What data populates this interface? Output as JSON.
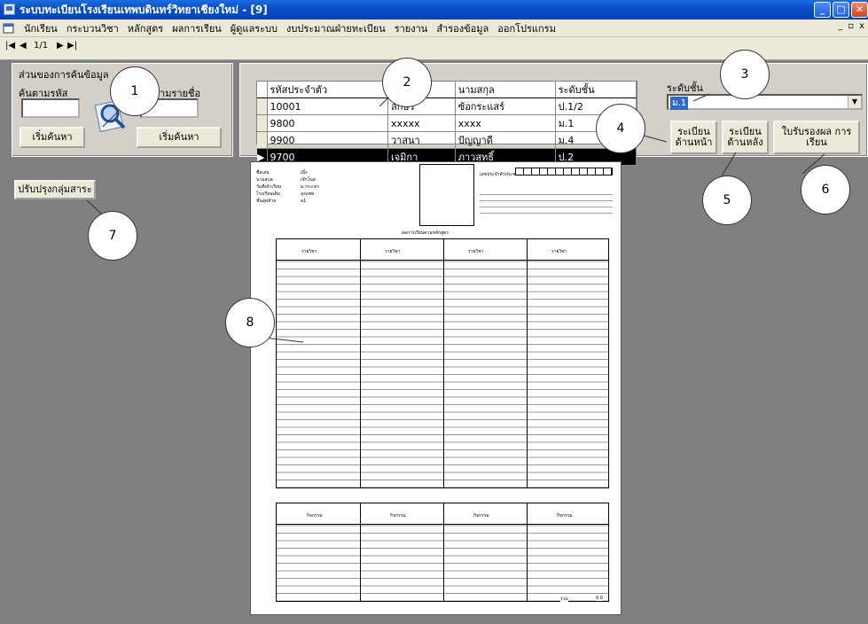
{
  "window": {
    "title": "ระบบทะเบียนโรงเรียนเทพบดินทร์วิทยาเชียงใหม่ - [9]"
  },
  "menu": [
    "นักเรียน",
    "กระบวนวิชา",
    "หลักสูตร",
    "ผลการเรียน",
    "ผู้ดูแลระบบ",
    "งบประมาณฝ่ายทะเบียน",
    "รายงาน",
    "สำรองข้อมูล",
    "ออกโปรแกรม"
  ],
  "nav": {
    "page": "1/1"
  },
  "search": {
    "group_title": "ส่วนของการค้นข้อมูล",
    "by_code_label": "ค้นตามรหัส",
    "by_name_label": "ค้นตามรายชื่อ",
    "code_value": "",
    "name_value": "",
    "search_button_1": "เริ่มค้นหา",
    "search_button_2": "เริ่มค้นหา"
  },
  "grid": {
    "columns": [
      "รหัสประจำตัว",
      "ชื่อ",
      "นามสกุล",
      "ระดับชั้น"
    ],
    "rows": [
      [
        "10001",
        "ลักษร",
        "ซ้อกระแสร์",
        "ป.1/2"
      ],
      [
        "9800",
        "xxxxx",
        "xxxx",
        "ม.1"
      ],
      [
        "9900",
        "วาสนา",
        "ปัญญาดี",
        "ม.4"
      ],
      [
        "9700",
        "เจมิกา",
        "ภาวสุทธิ์",
        "ป.2"
      ]
    ]
  },
  "level": {
    "label": "ระดับชั้น",
    "selected": "ม.1"
  },
  "buttons": {
    "front": "ระเบียน ด้านหน้า",
    "back": "ระเบียน ด้านหลัง",
    "certificate": "ใบรับรองผล การเรียน",
    "update_group": "ปรับปรุงกลุ่มสาระ"
  },
  "callouts": [
    "1",
    "2",
    "3",
    "4",
    "5",
    "6",
    "7",
    "8"
  ],
  "report": {
    "header_left": [
      "ชื่อเล่น",
      "นามสกุล",
      "วันที่เข้าเรียน",
      "โรงเรียนเดิม",
      "ชั้นสุดท้าย"
    ],
    "header_left_vals": [
      "เมิ้ง",
      "เจ๊กโนส",
      "ม.กระเหว",
      "ลุงแพท",
      "a1"
    ],
    "header_right": "เลขประจำตัวประชาชน",
    "section_title": "ผลการเรียนตามหลักสูตร",
    "col_header": "รายวิชา",
    "activity_header": "กิจกรรม",
    "total_label": "รวม",
    "total_value": "0.0"
  }
}
